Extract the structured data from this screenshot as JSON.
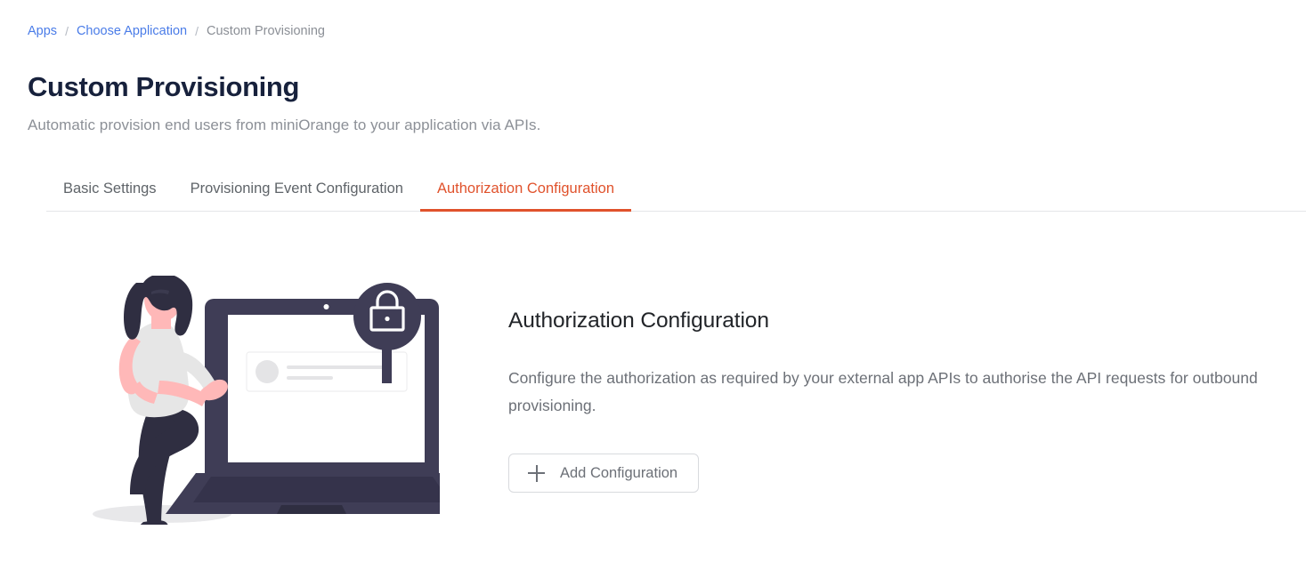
{
  "breadcrumb": {
    "items": [
      {
        "label": "Apps",
        "type": "link"
      },
      {
        "label": "Choose Application",
        "type": "link"
      },
      {
        "label": "Custom Provisioning",
        "type": "current"
      }
    ],
    "separator": "/"
  },
  "page": {
    "title": "Custom Provisioning",
    "subtitle": "Automatic provision end users from miniOrange to your application via APIs."
  },
  "tabs": [
    {
      "label": "Basic Settings",
      "active": false
    },
    {
      "label": "Provisioning Event Configuration",
      "active": false
    },
    {
      "label": "Authorization Configuration",
      "active": true
    }
  ],
  "empty_state": {
    "heading": "Authorization Configuration",
    "description": "Configure the authorization as required by your external app APIs to authorise the API requests for outbound provisioning.",
    "button_label": "Add Configuration",
    "button_icon": "plus-icon",
    "illustration_name": "woman-with-laptop-security-lock-illustration"
  },
  "colors": {
    "accent_orange": "#e0522c",
    "link_blue": "#4a7ce8",
    "title_dark": "#17213c",
    "muted_gray": "#8c9097",
    "illustration_dark": "#3f3d56",
    "illustration_hair": "#2f2e41",
    "illustration_skin": "#ffb8b8",
    "illustration_shirt": "#e6e6e6"
  }
}
